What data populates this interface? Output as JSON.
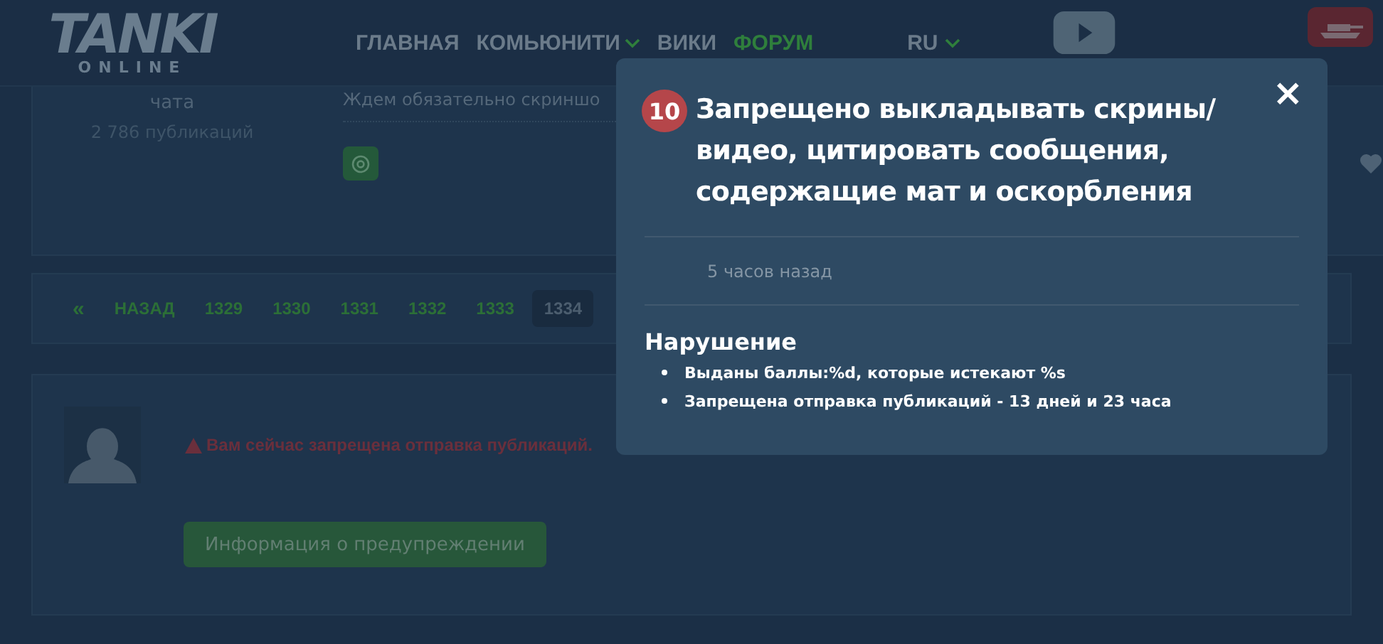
{
  "header": {
    "logo": "TANKI",
    "logo_sub": "ONLINE",
    "nav": [
      {
        "label": "ГЛАВНАЯ",
        "selected": false,
        "dropdown": false
      },
      {
        "label": "КОМЬЮНИТИ",
        "selected": false,
        "dropdown": true
      },
      {
        "label": "ВИКИ",
        "selected": false,
        "dropdown": false
      },
      {
        "label": "ФОРУМ",
        "selected": true,
        "dropdown": false
      }
    ],
    "language": "RU"
  },
  "post": {
    "author_rank": "чата",
    "author_posts": "2 786 публикаций",
    "text": "Ждем обязательно скриншо"
  },
  "pagination": {
    "first": "«",
    "back": "НАЗАД",
    "pages": [
      {
        "label": "1329",
        "selected": false
      },
      {
        "label": "1330",
        "selected": false
      },
      {
        "label": "1331",
        "selected": false
      },
      {
        "label": "1332",
        "selected": false
      },
      {
        "label": "1333",
        "selected": false
      },
      {
        "label": "1334",
        "selected": true
      }
    ]
  },
  "reply": {
    "warning": "Вам сейчас запрещена отправка публикаций.",
    "button": "Информация о предупреждении"
  },
  "popup": {
    "badge": "10",
    "title": "Запрещено выкладывать скрины/видео, цитировать сообщения, содержащие мат и оскорбления",
    "close": "×",
    "time": "5 часов назад",
    "section": "Нарушение",
    "items": [
      "Выданы баллы:%d, которые истекают %s",
      "Запрещена отправка публикаций - 13 дней и 23 часа"
    ]
  }
}
